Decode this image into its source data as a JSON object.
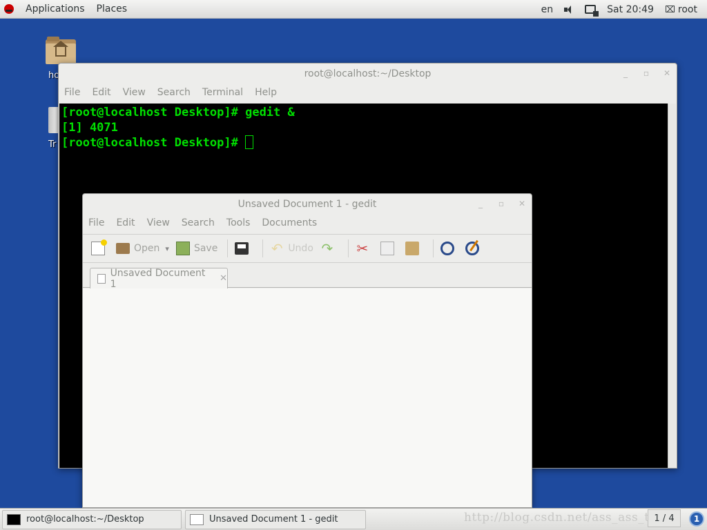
{
  "top_panel": {
    "applications": "Applications",
    "places": "Places",
    "lang": "en",
    "clock": "Sat 20:49",
    "user": "root"
  },
  "desktop": {
    "home_label": "ho",
    "trash_label": "Tr"
  },
  "terminal": {
    "title": "root@localhost:~/Desktop",
    "menu": [
      "File",
      "Edit",
      "View",
      "Search",
      "Terminal",
      "Help"
    ],
    "lines": [
      "[root@localhost Desktop]# gedit &",
      "[1] 4071",
      "[root@localhost Desktop]# "
    ]
  },
  "gedit": {
    "title": "Unsaved Document 1 - gedit",
    "menu": [
      "File",
      "Edit",
      "View",
      "Search",
      "Tools",
      "Documents"
    ],
    "toolbar": {
      "open": "Open",
      "save": "Save",
      "undo": "Undo"
    },
    "tab_label": "Unsaved Document 1"
  },
  "taskbar": {
    "task1": "root@localhost:~/Desktop",
    "task2": "Unsaved Document 1 - gedit",
    "workspace": "1 / 4",
    "notify_count": "1",
    "watermark": "http://blog.csdn.net/ass_ass_t"
  }
}
